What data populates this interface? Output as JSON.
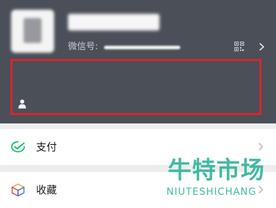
{
  "profile": {
    "wechat_id_label": "微信号:"
  },
  "menu": {
    "items": [
      {
        "label": "支付",
        "icon": "wechat-pay-icon"
      },
      {
        "label": "收藏",
        "icon": "favorites-cube-icon"
      }
    ]
  },
  "watermark": {
    "chinese": "牛特市场",
    "english": "NIUTESHICHANG"
  },
  "colors": {
    "header_bg": "#4b4f58",
    "highlight": "#d7262b",
    "pay_green": "#07c160",
    "watermark": "#2fb39a"
  }
}
